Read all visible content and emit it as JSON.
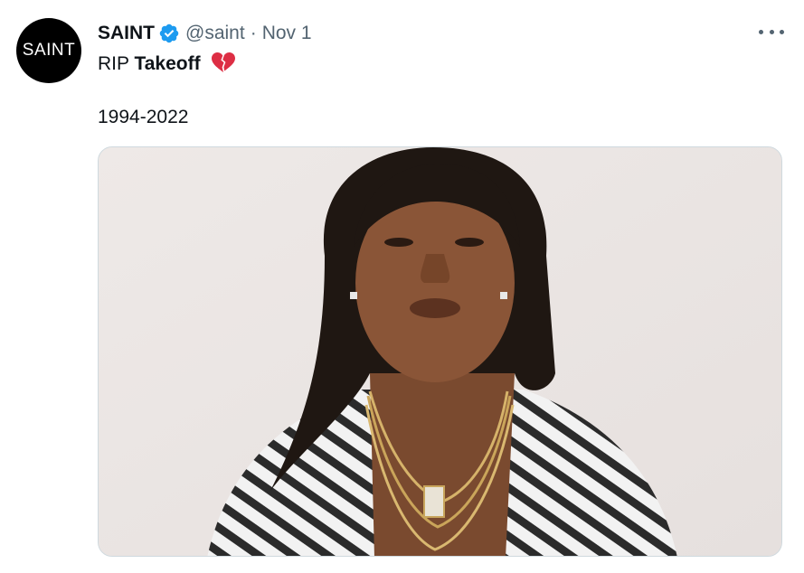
{
  "tweet": {
    "author": {
      "display_name": "SAINT",
      "handle": "@saint",
      "avatar_text": "SAINT",
      "verified_icon": "verified-badge-icon",
      "verified_color": "#1d9bf0"
    },
    "separator": "·",
    "date": "Nov 1",
    "text": {
      "prefix": "RIP ",
      "bold": "Takeoff",
      "emoji_icon": "broken-heart-icon",
      "line2": "1994-2022"
    },
    "media": {
      "alt_icon": "photo"
    },
    "more_icon": "more-horizontal-icon",
    "colors": {
      "text": "#0f1419",
      "secondary": "#536471",
      "media_background": "#ebe6e4"
    }
  }
}
